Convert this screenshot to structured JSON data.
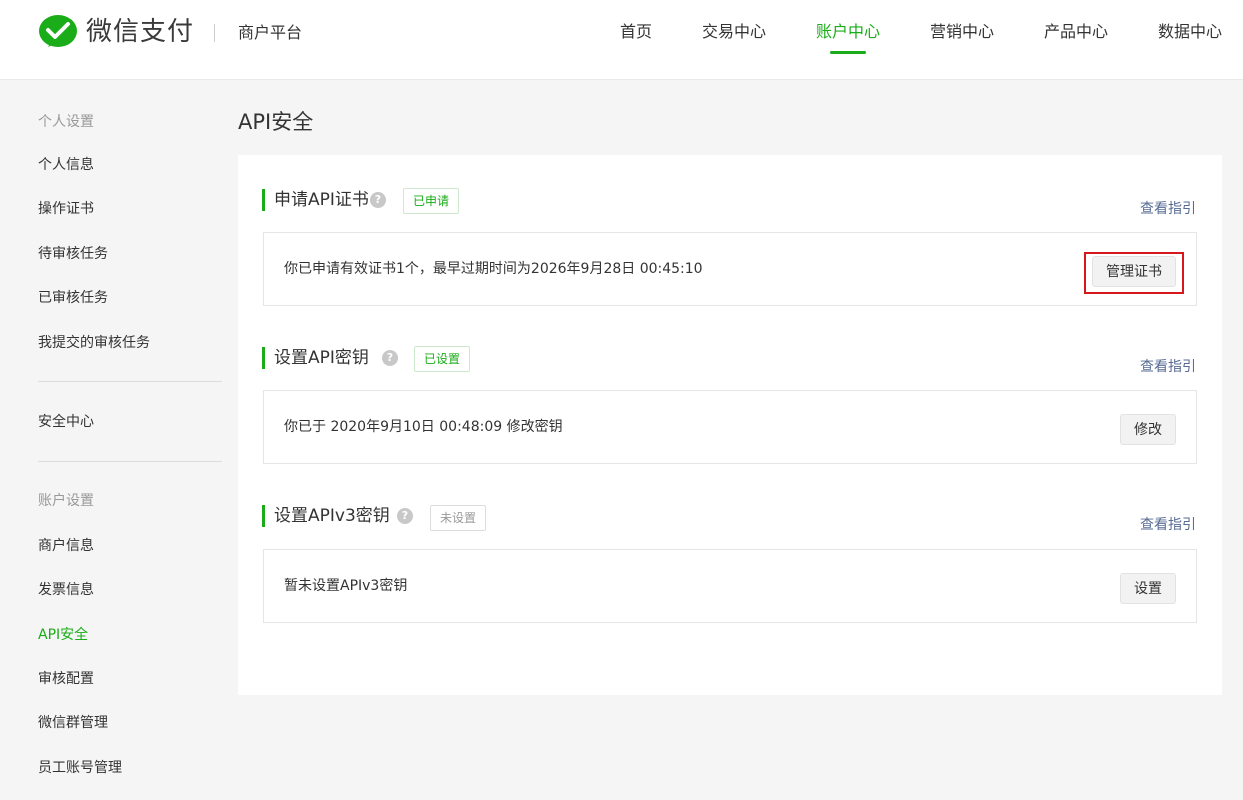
{
  "header": {
    "brand": "微信支付",
    "platform": "商户平台",
    "nav": [
      "首页",
      "交易中心",
      "账户中心",
      "营销中心",
      "产品中心",
      "数据中心"
    ],
    "active_nav": "账户中心"
  },
  "sidebar": {
    "group_personal": "个人设置",
    "personal_items": [
      "个人信息",
      "操作证书",
      "待审核任务",
      "已审核任务",
      "我提交的审核任务"
    ],
    "security_center": "安全中心",
    "group_account": "账户设置",
    "account_items": [
      "商户信息",
      "发票信息",
      "API安全",
      "审核配置",
      "微信群管理",
      "员工账号管理"
    ],
    "active_item": "API安全"
  },
  "main": {
    "page_title": "API安全",
    "sections": [
      {
        "title": "申请API证书",
        "status": "已申请",
        "guide_link": "查看指引",
        "text": "你已申请有效证书1个，最早过期时间为2026年9月28日 00:45:10",
        "button": "管理证书"
      },
      {
        "title": "设置API密钥",
        "status": "已设置",
        "guide_link": "查看指引",
        "text": "你已于 2020年9月10日 00:48:09 修改密钥",
        "button": "修改"
      },
      {
        "title": "设置APIv3密钥",
        "status": "未设置",
        "guide_link": "查看指引",
        "text": "暂未设置APIv3密钥",
        "button": "设置"
      }
    ]
  },
  "colors": {
    "accent": "#1aad19",
    "link": "#576b95",
    "highlight_border": "#d6171c"
  },
  "icons": {
    "logo": "wechat-pay-logo-icon",
    "help": "question-circle-icon"
  }
}
